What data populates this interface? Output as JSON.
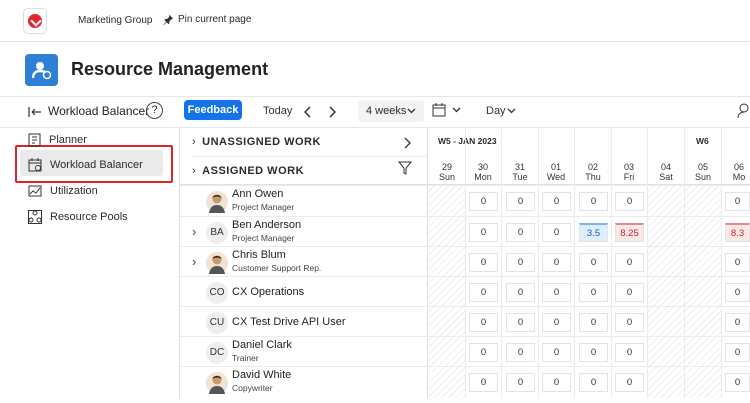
{
  "topbar": {
    "group": "Marketing Group",
    "pin_label": "Pin current page"
  },
  "header": {
    "title": "Resource Management"
  },
  "toolbar": {
    "view_title": "Workload Balancer",
    "help": "?",
    "feedback": "Feedback",
    "today": "Today",
    "range": "4 weeks",
    "granularity": "Day"
  },
  "sidebar": {
    "items": [
      "Planner",
      "Workload Balancer",
      "Utilization",
      "Resource Pools"
    ]
  },
  "grid": {
    "unassigned": "UNASSIGNED WORK",
    "assigned": "ASSIGNED WORK",
    "week1": "W5 - JAN 2023",
    "week2": "W6",
    "days": [
      {
        "num": "29",
        "dow": "Sun"
      },
      {
        "num": "30",
        "dow": "Mon"
      },
      {
        "num": "31",
        "dow": "Tue"
      },
      {
        "num": "01",
        "dow": "Wed"
      },
      {
        "num": "02",
        "dow": "Thu"
      },
      {
        "num": "03",
        "dow": "Fri"
      },
      {
        "num": "04",
        "dow": "Sat"
      },
      {
        "num": "05",
        "dow": "Sun"
      },
      {
        "num": "06",
        "dow": "Mo"
      }
    ],
    "people": [
      {
        "name": "Ann Owen",
        "role": "Project Manager",
        "initials": "",
        "values": [
          "0",
          "0",
          "0",
          "0",
          "0",
          "0"
        ],
        "extra": ""
      },
      {
        "name": "Ben Anderson",
        "role": "Project Manager",
        "initials": "BA",
        "values": [
          "0",
          "0",
          "0",
          "3.5",
          "8.25",
          "8.3"
        ],
        "extra": ""
      },
      {
        "name": "Chris Blum",
        "role": "Customer Support Rep.",
        "initials": "",
        "values": [
          "0",
          "0",
          "0",
          "0",
          "0",
          "0"
        ],
        "extra": ""
      },
      {
        "name": "CX Operations",
        "role": "",
        "initials": "CO",
        "values": [
          "0",
          "0",
          "0",
          "0",
          "0",
          "0"
        ],
        "extra": ""
      },
      {
        "name": "CX Test Drive API User",
        "role": "",
        "initials": "CU",
        "values": [
          "0",
          "0",
          "0",
          "0",
          "0",
          "0"
        ],
        "extra": ""
      },
      {
        "name": "Daniel Clark",
        "role": "Trainer",
        "initials": "DC",
        "values": [
          "0",
          "0",
          "0",
          "0",
          "0",
          "0"
        ],
        "extra": ""
      },
      {
        "name": "David White",
        "role": "Copywriter",
        "initials": "",
        "values": [
          "0",
          "0",
          "0",
          "0",
          "0",
          "0"
        ],
        "extra": ""
      }
    ]
  },
  "colors": {
    "accent": "#1473e6",
    "highlight": "#e0232b",
    "app_icon": "#2f7fd6"
  }
}
